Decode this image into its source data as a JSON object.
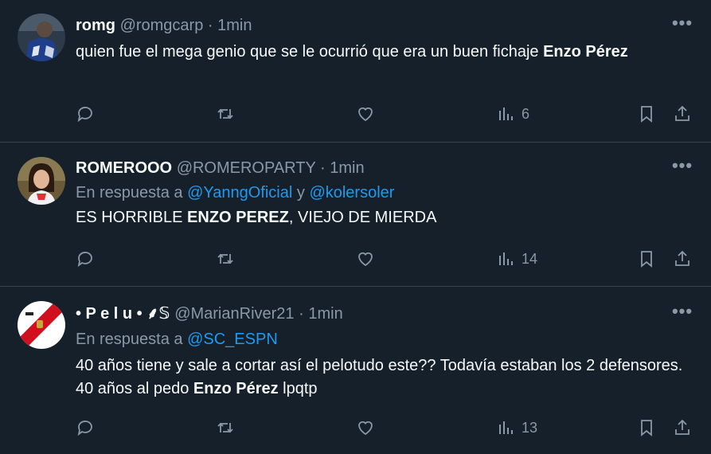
{
  "tweets": [
    {
      "name": "romg",
      "handle": "@romgcarp",
      "sep": "·",
      "time": "1min",
      "reply_prefix": "",
      "mentions": [],
      "text_parts": [
        {
          "t": "quien fue el mega genio que se le ocurrió que era un buen fichaje ",
          "b": false
        },
        {
          "t": "Enzo Pérez",
          "b": true
        }
      ],
      "views": "6"
    },
    {
      "name": "ROMEROOO",
      "handle": "@ROMEROPARTY",
      "sep": "·",
      "time": "1min",
      "reply_prefix": "En respuesta a",
      "reply_and": "y",
      "mentions": [
        "@YanngOficial",
        "@kolersoler"
      ],
      "text_parts": [
        {
          "t": "ES HORRIBLE ",
          "b": false
        },
        {
          "t": "ENZO PEREZ",
          "b": true
        },
        {
          "t": ", VIEJO DE MIERDA",
          "b": false
        }
      ],
      "views": "14"
    },
    {
      "name": "• P e l u •  ⸙𝕊",
      "handle": "@MarianRiver21",
      "sep": "·",
      "time": "1min",
      "reply_prefix": "En respuesta a",
      "mentions": [
        "@SC_ESPN"
      ],
      "text_parts": [
        {
          "t": "40 años tiene y sale a cortar así el pelotudo este?? Todavía estaban los 2 defensores. 40 años al pedo ",
          "b": false
        },
        {
          "t": "Enzo Pérez",
          "b": true
        },
        {
          "t": " lpqtp",
          "b": false
        }
      ],
      "views": "13"
    }
  ],
  "icons": {
    "more": "more-icon",
    "reply": "reply-icon",
    "retweet": "retweet-icon",
    "like": "heart-icon",
    "views": "views-icon",
    "bookmark": "bookmark-icon",
    "share": "share-icon"
  },
  "colors": {
    "background": "#15202b",
    "text": "#f7f9f9",
    "muted": "#8b98a5",
    "mention": "#1d9bf0",
    "divider": "#38444d"
  }
}
